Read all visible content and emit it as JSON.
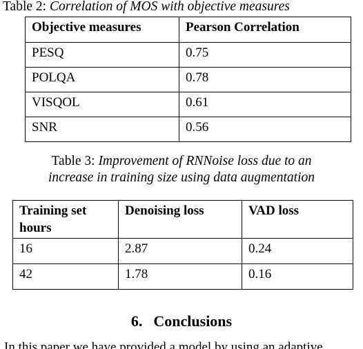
{
  "document": {
    "table2": {
      "caption_label": "Table 2:",
      "caption_title": "Correlation of MOS with objective measures",
      "columns": [
        "Objective measures",
        "Pearson Correlation"
      ],
      "rows": [
        [
          "PESQ",
          "0.75"
        ],
        [
          "POLQA",
          "0.78"
        ],
        [
          "VISQOL",
          "0.61"
        ],
        [
          "SNR",
          "0.56"
        ]
      ]
    },
    "table3": {
      "caption_label": "Table 3:",
      "caption_title_line1": "Improvement of RNNoise loss due to an",
      "caption_title_line2": "increase in training size using data augmentation",
      "columns": [
        "Training set hours",
        "Denoising loss",
        "VAD loss"
      ],
      "rows": [
        [
          "16",
          "2.87",
          "0.24"
        ],
        [
          "42",
          "1.78",
          "0.16"
        ]
      ]
    },
    "section": {
      "number": "6.",
      "title": "Conclusions"
    },
    "body": {
      "paragraph": "In this paper we have provided a model by using an adaptive"
    },
    "colors": {
      "text": "#000000",
      "background": "#ffffff",
      "rule": "#000000"
    }
  }
}
